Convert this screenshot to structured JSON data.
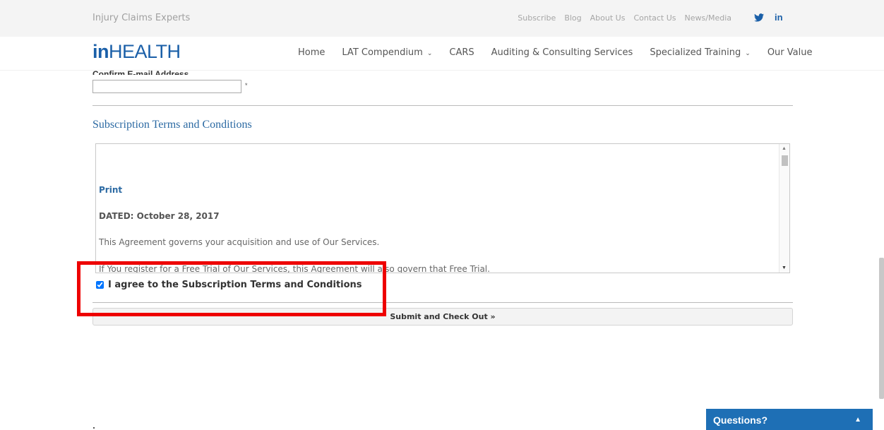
{
  "topbar": {
    "brand": "Injury Claims Experts",
    "links": [
      "Subscribe",
      "Blog",
      "About Us",
      "Contact Us",
      "News/Media"
    ],
    "social": {
      "twitter": "twitter-icon",
      "linkedin": "in"
    }
  },
  "nav": {
    "logo_in": "in",
    "logo_health": "HEALTH",
    "items": [
      {
        "label": "Home"
      },
      {
        "label": "LAT Compendium",
        "dropdown": true
      },
      {
        "label": "CARS"
      },
      {
        "label": "Auditing & Consulting Services"
      },
      {
        "label": "Specialized Training",
        "dropdown": true
      },
      {
        "label": "Our Value"
      }
    ]
  },
  "form": {
    "confirm_email_label": "Confirm E-mail Address",
    "confirm_email_value": "",
    "required_marker": "*",
    "section_title": "Subscription Terms and Conditions",
    "terms": {
      "print": "Print",
      "dated": "DATED: October 28, 2017",
      "p1": "This Agreement governs your acquisition and use of Our Services.",
      "p2": "If You register for a Free Trial of Our Services, this Agreement will also govern that Free Trial."
    },
    "agree_label": "I agree to the Subscription Terms and Conditions",
    "agree_checked": true,
    "submit_label": "Submit and Check Out »"
  },
  "chat": {
    "label": "Questions?"
  },
  "colors": {
    "brand_blue": "#1a5fa8",
    "link_blue": "#2c6aa3",
    "chat_blue": "#1e6fb5",
    "highlight_red": "#ee0000"
  }
}
